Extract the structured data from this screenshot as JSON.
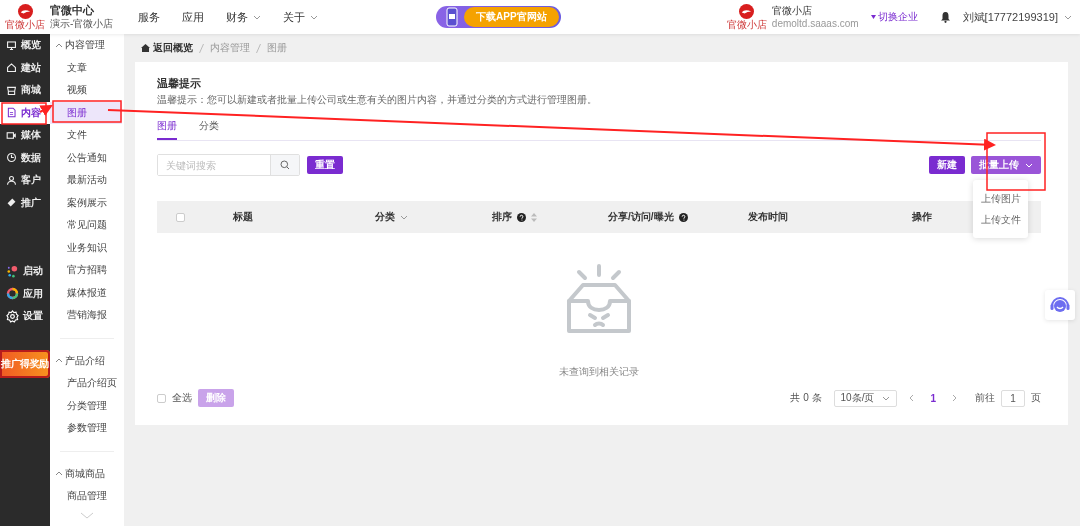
{
  "header": {
    "logo_caption": "官微小店",
    "brand_title": "官微中心",
    "brand_subtitle": "演示-官微小店",
    "nav": [
      {
        "label": "服务",
        "has_dropdown": false
      },
      {
        "label": "应用",
        "has_dropdown": false
      },
      {
        "label": "财务",
        "has_dropdown": true
      },
      {
        "label": "关于",
        "has_dropdown": true
      }
    ],
    "promo": "下载APP官网站",
    "shop_logo_caption": "官微小店",
    "shop_name": "官微小店",
    "shop_domain": "demoltd.saaas.com",
    "switch_label": "切换企业",
    "user": "刘斌[17772199319]"
  },
  "main_nav": {
    "items": [
      {
        "label": "概览",
        "selected": false
      },
      {
        "label": "建站",
        "selected": false
      },
      {
        "label": "商城",
        "selected": false
      },
      {
        "label": "内容",
        "selected": true
      },
      {
        "label": "媒体",
        "selected": false
      },
      {
        "label": "数据",
        "selected": false
      },
      {
        "label": "客户",
        "selected": false
      },
      {
        "label": "推广",
        "selected": false
      }
    ],
    "apps": [
      {
        "label": "启动"
      },
      {
        "label": "应用"
      },
      {
        "label": "设置"
      }
    ],
    "promo": "推广得奖励"
  },
  "sub_nav": [
    {
      "title": "内容管理",
      "expanded": true,
      "items": [
        {
          "label": "文章",
          "selected": false
        },
        {
          "label": "视频",
          "selected": false
        },
        {
          "label": "图册",
          "selected": true
        },
        {
          "label": "文件",
          "selected": false
        },
        {
          "label": "公告通知",
          "selected": false
        },
        {
          "label": "最新活动",
          "selected": false
        },
        {
          "label": "案例展示",
          "selected": false
        },
        {
          "label": "常见问题",
          "selected": false
        },
        {
          "label": "业务知识",
          "selected": false
        },
        {
          "label": "官方招聘",
          "selected": false
        },
        {
          "label": "媒体报道",
          "selected": false
        },
        {
          "label": "营销海报",
          "selected": false
        }
      ]
    },
    {
      "title": "产品介绍",
      "expanded": true,
      "items": [
        {
          "label": "产品介绍页",
          "selected": false
        },
        {
          "label": "分类管理",
          "selected": false
        },
        {
          "label": "参数管理",
          "selected": false
        }
      ]
    },
    {
      "title": "商城商品",
      "expanded": true,
      "items": [
        {
          "label": "商品管理",
          "selected": false
        }
      ]
    }
  ],
  "breadcrumb": [
    "返回概览",
    "内容管理",
    "图册"
  ],
  "notice": {
    "title": "温馨提示",
    "text": "温馨提示：您可以新建或者批量上传公司或生意有关的图片内容，并通过分类的方式进行管理图册。"
  },
  "tabs": [
    {
      "label": "图册",
      "selected": true
    },
    {
      "label": "分类",
      "selected": false
    }
  ],
  "search": {
    "placeholder": "关键词搜索"
  },
  "reset_button": "重置",
  "new_button": "新建",
  "upload_button": "批量上传",
  "upload_menu": [
    "上传图片",
    "上传文件"
  ],
  "table": {
    "select_all_checked": false,
    "columns": [
      {
        "label": "标题",
        "kind": "plain"
      },
      {
        "label": "分类",
        "kind": "filter"
      },
      {
        "label": "排序",
        "kind": "help-sort"
      },
      {
        "label": "分享/访问/曝光",
        "kind": "help"
      },
      {
        "label": "发布时间",
        "kind": "plain"
      },
      {
        "label": "操作",
        "kind": "plain"
      }
    ],
    "empty_text": "未查询到相关记录"
  },
  "footer": {
    "select_all": {
      "label": "全选",
      "checked": false
    },
    "delete_button": {
      "label": "删除",
      "disabled": true
    },
    "total": "共 0 条",
    "page_size": "10条/页",
    "pages": [
      {
        "label": "1",
        "selected": true
      }
    ],
    "goto_label": "前往",
    "goto_value": "1",
    "goto_suffix": "页"
  }
}
